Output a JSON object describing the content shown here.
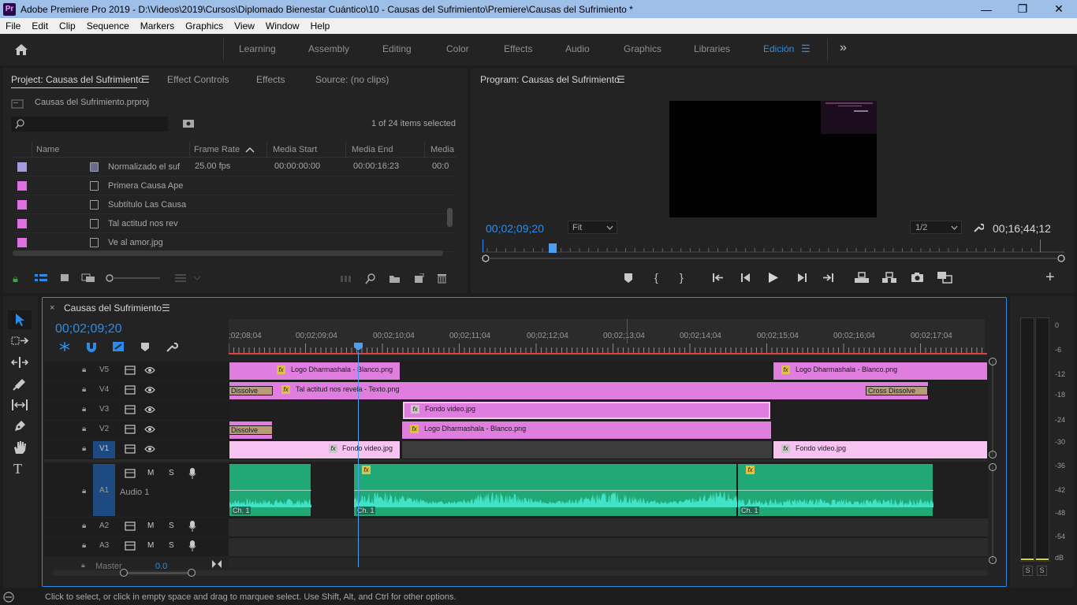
{
  "window": {
    "app_icon": "Pr",
    "title": "Adobe Premiere Pro 2019 - D:\\Videos\\2019\\Cursos\\Diplomado Bienestar Cuántico\\10 - Causas del Sufrimiento\\Premiere\\Causas del Sufrimiento *",
    "minimize": "—",
    "restore": "❐",
    "close": "✕"
  },
  "menu": [
    "File",
    "Edit",
    "Clip",
    "Sequence",
    "Markers",
    "Graphics",
    "View",
    "Window",
    "Help"
  ],
  "workspaces": {
    "items": [
      "Learning",
      "Assembly",
      "Editing",
      "Color",
      "Effects",
      "Audio",
      "Graphics",
      "Libraries",
      "Edición"
    ],
    "active": "Edición",
    "more": "»"
  },
  "project_panel": {
    "tabs": [
      "Project: Causas del Sufrimiento",
      "Effect Controls",
      "Effects",
      "Source: (no clips)"
    ],
    "file_name": "Causas del Sufrimiento.prproj",
    "search_placeholder": "",
    "items_selected": "1 of 24 items selected",
    "columns": [
      "Name",
      "Frame Rate",
      "Media Start",
      "Media End",
      "Media"
    ],
    "rows": [
      {
        "name": "Normalizado el suf",
        "frame_rate": "25.00 fps",
        "media_start": "00:00:00:00",
        "media_end": "00:00:16:23",
        "media": "00:0",
        "color": "#a898e0"
      },
      {
        "name": "Primera Causa Ape",
        "frame_rate": "",
        "media_start": "",
        "media_end": "",
        "media": "",
        "color": "#e070e0"
      },
      {
        "name": "Subtítulo Las Causa",
        "frame_rate": "",
        "media_start": "",
        "media_end": "",
        "media": "",
        "color": "#e070e0"
      },
      {
        "name": "Tal actitud nos rev",
        "frame_rate": "",
        "media_start": "",
        "media_end": "",
        "media": "",
        "color": "#e070e0"
      },
      {
        "name": "Ve al amor.jpg",
        "frame_rate": "",
        "media_start": "",
        "media_end": "",
        "media": "",
        "color": "#e070e0"
      }
    ]
  },
  "program_monitor": {
    "title": "Program: Causas del Sufrimiento",
    "timecode": "00;02;09;20",
    "fit": "Fit",
    "resolution": "1/2",
    "duration": "00;16;44;12",
    "add": "+"
  },
  "timeline": {
    "sequence_name": "Causas del Sufrimiento",
    "timecode": "00;02;09;20",
    "ruler": ";02;08;04|00;02;09;04|00;02;10;04|00;02;11;04|00;02;12;04|00;02;13;04|00;02;14;04|00;02;15;04|00;02;16;04|00;02;17;04",
    "ruler_labels": [
      ";02;08;04",
      "00;02;09;04",
      "00;02;10;04",
      "00;02;11;04",
      "00;02;12;04",
      "00;02;13;04",
      "00;02;14;04",
      "00;02;15;04",
      "00;02;16;04",
      "00;02;17;04"
    ],
    "video_tracks": [
      "V5",
      "V4",
      "V3",
      "V2",
      "V1"
    ],
    "audio_tracks": [
      {
        "id": "A1",
        "name": "Audio 1"
      },
      {
        "id": "A2",
        "name": ""
      },
      {
        "id": "A3",
        "name": ""
      }
    ],
    "master": "Master",
    "master_value": "0.0",
    "mute": "M",
    "solo": "S",
    "clips": {
      "v5_a": "Logo Dharmashala - Blanco.png",
      "v5_b": "Logo Dharmashala - Blanco.png",
      "v4_trans_a": "Dissolve",
      "v4_main": "Tal actitud nos revela - Texto.png",
      "v4_trans_b": "Cross Dissolve",
      "v3_main": "Fondo video.jpg",
      "v2_trans": "Dissolve",
      "v2_main": "Logo Dharmashala - Blanco.png",
      "v1_a": "Fondo video.jpg",
      "v1_b": "Fondo video.jpg",
      "a1_ch": "Ch. 1",
      "fx": "fx"
    }
  },
  "audio_meter": {
    "labels": [
      "0",
      "-6",
      "-12",
      "-18",
      "-24",
      "-30",
      "-36",
      "-42",
      "-48",
      "-54",
      "dB"
    ],
    "solo_left": "S",
    "solo_right": "S"
  },
  "status_bar": "Click to select, or click in empty space and drag to marquee select. Use Shift, Alt, and Ctrl for other options.",
  "colors": {
    "accent": "#2d8ceb",
    "video_clip": "#e07ee0",
    "video_clip_light": "#f7c3f0",
    "audio_clip": "#21a877",
    "waveform": "#41e3c8",
    "playhead": "#4a9ff0"
  }
}
